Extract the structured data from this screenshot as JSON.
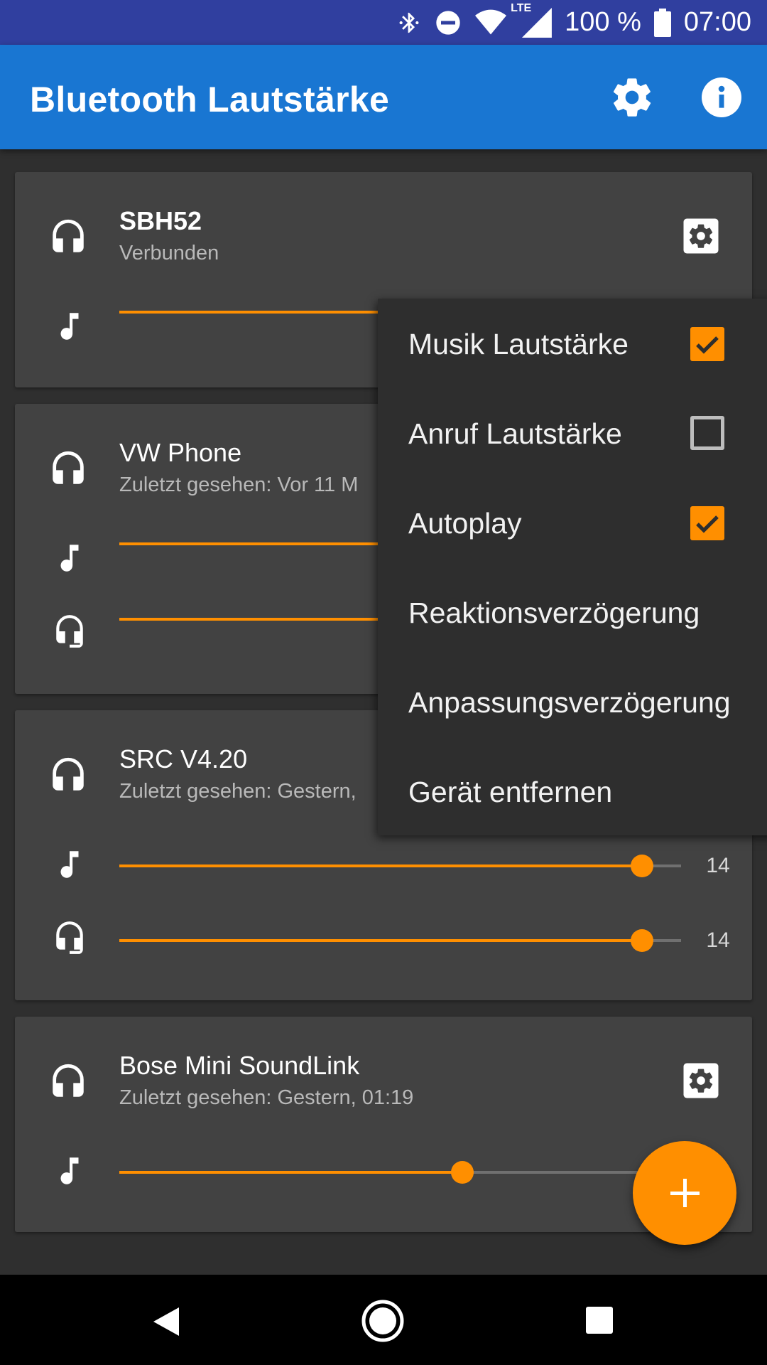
{
  "status": {
    "lte": "LTE",
    "battery": "100 %",
    "time": "07:00"
  },
  "appbar": {
    "title": "Bluetooth Lautstärke",
    "settings_icon": "gear-icon",
    "info_icon": "info-icon"
  },
  "devices": [
    {
      "name": "SBH52",
      "status": "Verbunden",
      "music_volume": null,
      "call_volume": null
    },
    {
      "name": "VW Phone",
      "status": "Zuletzt gesehen: Vor 11 M",
      "music_volume": null,
      "call_volume": null
    },
    {
      "name": "SRC V4.20",
      "status": "Zuletzt gesehen: Gestern,",
      "music_volume": "14",
      "call_volume": "14",
      "music_level": 0.93,
      "call_level": 0.93
    },
    {
      "name": "Bose Mini SoundLink",
      "status": "Zuletzt gesehen: Gestern, 01:19",
      "music_level": 0.61
    }
  ],
  "menu": {
    "items": [
      {
        "label": "Musik Lautstärke",
        "checked": true
      },
      {
        "label": "Anruf Lautstärke",
        "checked": false
      },
      {
        "label": "Autoplay",
        "checked": true
      },
      {
        "label": "Reaktionsverzögerung"
      },
      {
        "label": "Anpassungsverzögerung"
      },
      {
        "label": "Gerät entfernen"
      }
    ]
  },
  "colors": {
    "accent": "#ff8f00",
    "appbar": "#1976d2",
    "statusbar": "#303f9f",
    "card": "#424242",
    "background": "#2f2f2f"
  },
  "fab": {
    "icon": "plus-icon"
  }
}
